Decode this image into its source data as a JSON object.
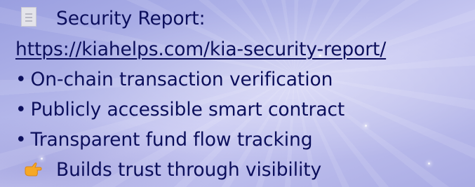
{
  "slide": {
    "report_label": "Security Report:",
    "report_link": "https://kiahelps.com/kia-security-report/",
    "bullets": [
      "On-chain transaction verification",
      "Publicly accessible smart contract",
      "Transparent fund flow tracking"
    ],
    "bullet_marker": "•",
    "closing_line": "Builds trust through visibility"
  },
  "icons": {
    "report": "document-icon",
    "closing": "pointing-hand-icon"
  },
  "colors": {
    "text": "#0c0f5c",
    "hand": "#f6a826"
  }
}
